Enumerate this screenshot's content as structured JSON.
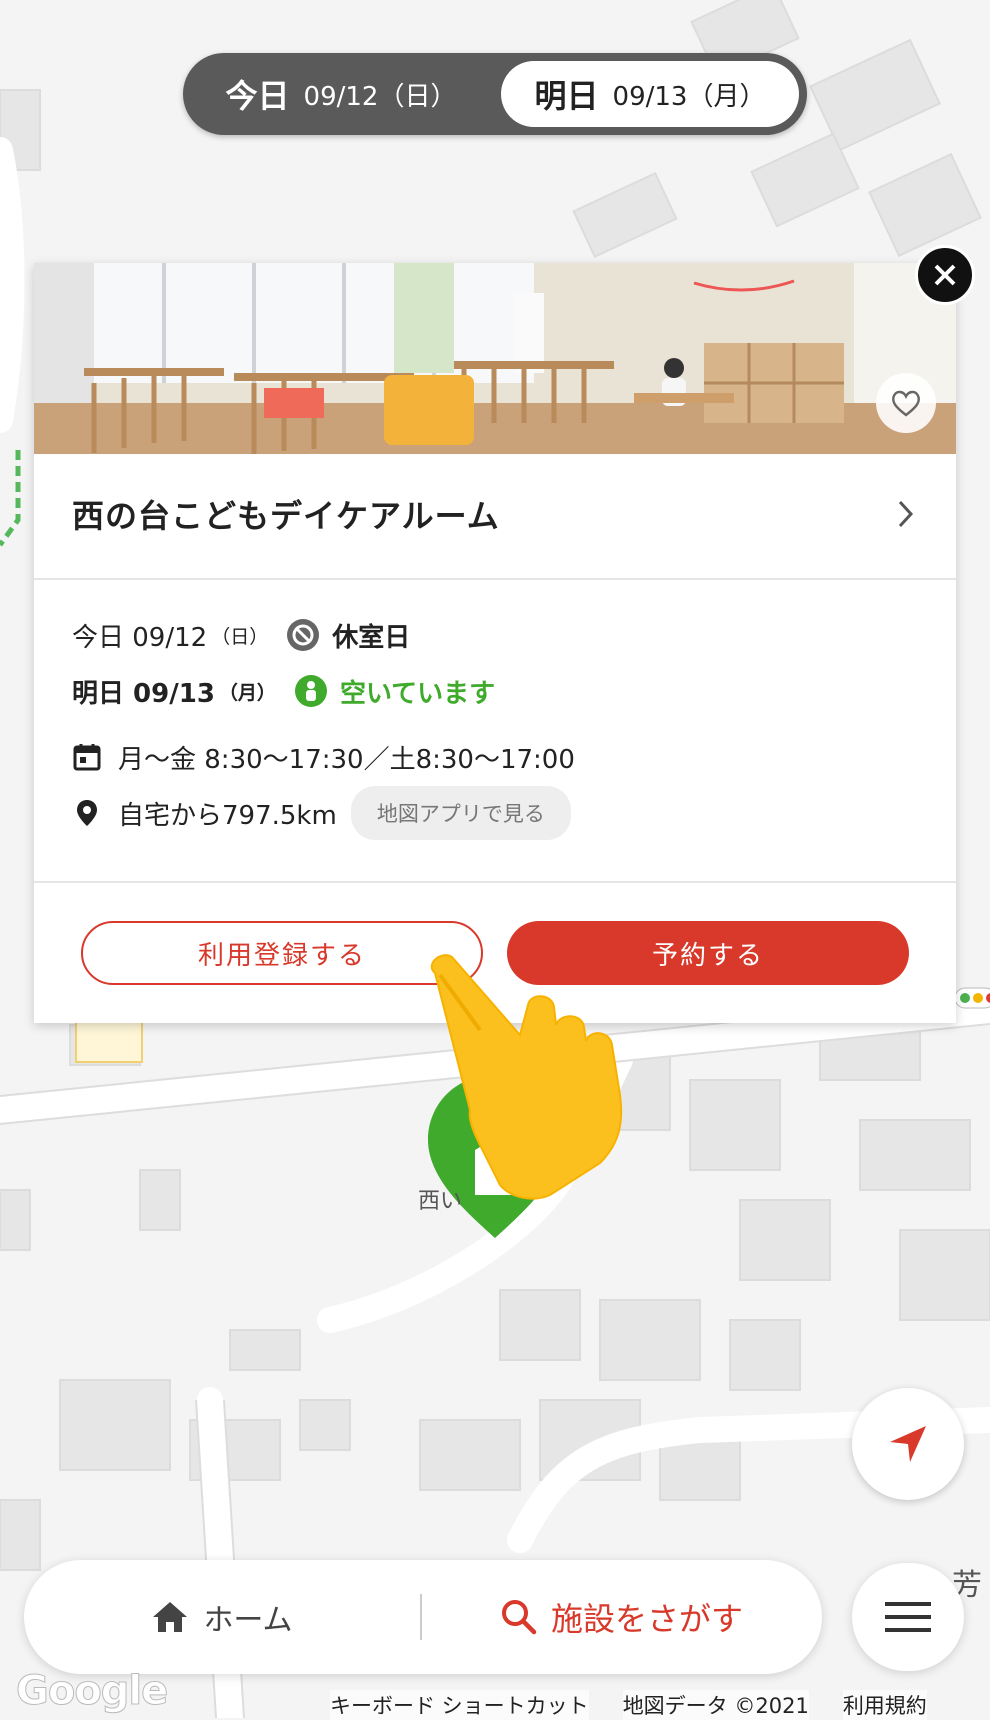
{
  "date_toggle": {
    "today": {
      "day": "今日",
      "date": "09/12（日）"
    },
    "tomorrow": {
      "day": "明日",
      "date": "09/13（月）"
    }
  },
  "facility": {
    "name": "西の台こどもデイケアルーム",
    "today": {
      "label": "今日 09/12",
      "weekday": "（日）",
      "status": "休室日"
    },
    "tomorrow": {
      "label": "明日 09/13",
      "weekday": "（月）",
      "status": "空いています"
    },
    "hours": "月〜金 8:30〜17:30／土8:30〜17:00",
    "distance": "自宅から797.5km",
    "map_link": "地図アプリで見る"
  },
  "actions": {
    "register": "利用登録する",
    "reserve": "予約する"
  },
  "nav": {
    "home": "ホーム",
    "search": "施設をさがす"
  },
  "map": {
    "marker_label": "西い",
    "corner_label": "芳",
    "google": "Google",
    "footer": {
      "shortcuts": "キーボード ショートカット",
      "data": "地図データ ©2021",
      "terms": "利用規約"
    }
  },
  "colors": {
    "accent": "#d8392a",
    "available": "#3faa2b",
    "toggle_bg": "#5a5a5a"
  }
}
